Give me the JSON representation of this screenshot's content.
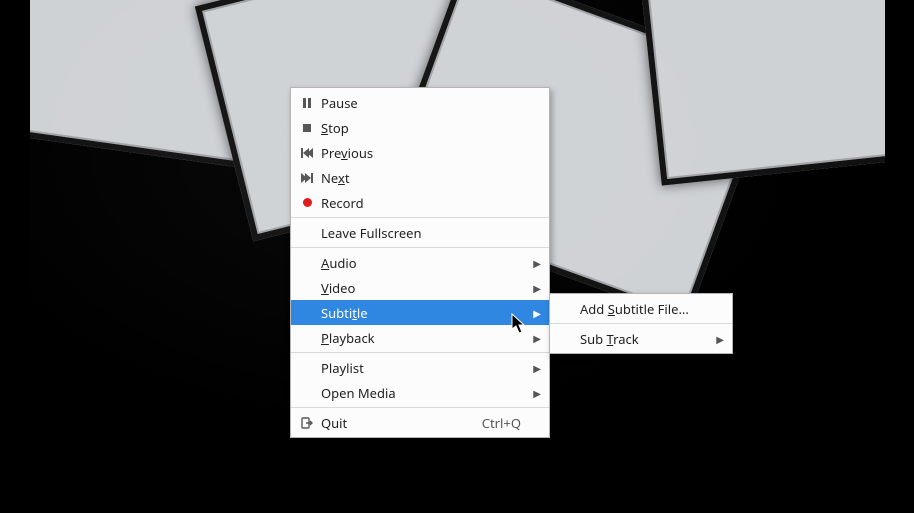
{
  "menu": {
    "pause": {
      "label_pre": "",
      "mn": "",
      "label_post": "Pause"
    },
    "stop": {
      "label_pre": "",
      "mn": "S",
      "label_post": "top"
    },
    "prev": {
      "label_pre": "Pre",
      "mn": "v",
      "label_post": "ious"
    },
    "next": {
      "label_pre": "Ne",
      "mn": "x",
      "label_post": "t"
    },
    "record": {
      "label_pre": "",
      "mn": "",
      "label_post": "Record"
    },
    "leave": {
      "label_pre": "",
      "mn": "",
      "label_post": "Leave Fullscreen"
    },
    "audio": {
      "label_pre": "",
      "mn": "A",
      "label_post": "udio"
    },
    "video": {
      "label_pre": "",
      "mn": "V",
      "label_post": "ideo"
    },
    "subtitle": {
      "label_pre": "Subti",
      "mn": "t",
      "label_post": "le"
    },
    "playback": {
      "label_pre": "",
      "mn": "P",
      "label_post": "layback"
    },
    "playlist": {
      "label_pre": "",
      "mn": "",
      "label_post": "Playlist"
    },
    "openmedia": {
      "label_pre": "",
      "mn": "",
      "label_post": "Open Media"
    },
    "quit": {
      "label_pre": "",
      "mn": "",
      "label_post": "Quit",
      "accel": "Ctrl+Q"
    }
  },
  "submenu": {
    "add_sub": {
      "label_pre": "Add ",
      "mn": "S",
      "label_post": "ubtitle File..."
    },
    "subtrack": {
      "label_pre": "Sub ",
      "mn": "T",
      "label_post": "rack"
    }
  },
  "colors": {
    "highlight": "#2f87e2",
    "menu_bg": "#fcfcfc",
    "record": "#e01b1b"
  }
}
